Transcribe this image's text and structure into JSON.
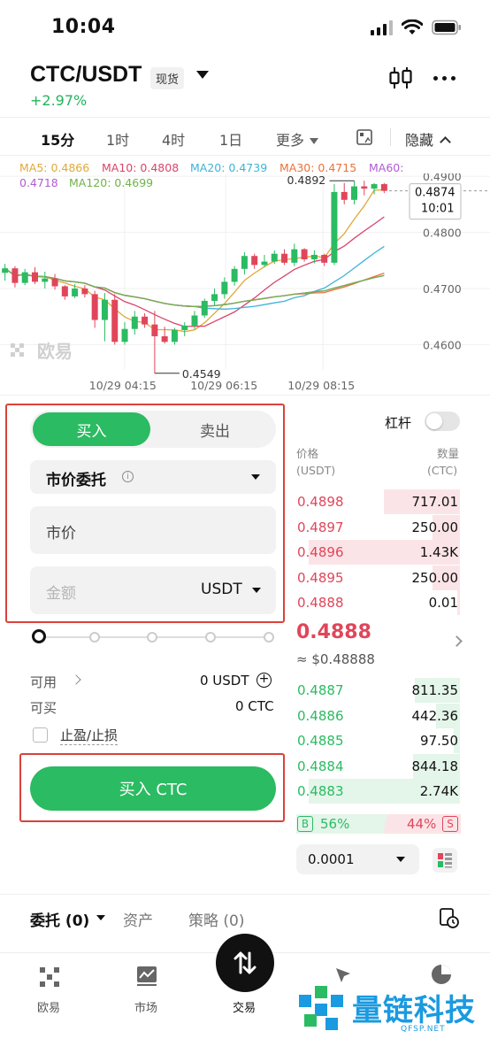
{
  "status_bar": {
    "time": "10:04"
  },
  "header": {
    "pair": "CTC/USDT",
    "badge": "现货",
    "change": "+2.97%",
    "colors": {
      "up": "#2bbb62",
      "down": "#e0465a"
    }
  },
  "intervals": {
    "items": [
      "15分",
      "1时",
      "4时",
      "1日",
      "更多"
    ],
    "hide_label": "隐藏"
  },
  "ma_legend": {
    "ma5": "MA5: 0.4866",
    "ma10": "MA10: 0.4808",
    "ma20": "MA20: 0.4739",
    "ma30": "MA30: 0.4715",
    "ma60_a": "MA60:",
    "ma60_b": "0.4718",
    "ma120": "MA120: 0.4699"
  },
  "chart_data": {
    "type": "candlestick",
    "y_ticks": [
      "0.4900",
      "0.4800",
      "0.4700",
      "0.4600"
    ],
    "x_ticks": [
      "10/29 04:15",
      "10/29 06:15",
      "10/29 08:15"
    ],
    "high_label": "0.4892",
    "low_label": "0.4549",
    "last_price_tag": "0.4874",
    "last_time_tag": "10:01",
    "watermark": "欧易",
    "ylim": [
      0.4555,
      0.4905
    ],
    "candles": [
      [
        0.4728,
        0.4744,
        0.4714,
        0.4736
      ],
      [
        0.4736,
        0.474,
        0.4702,
        0.471
      ],
      [
        0.471,
        0.4735,
        0.4706,
        0.4729
      ],
      [
        0.4729,
        0.4738,
        0.4708,
        0.4712
      ],
      [
        0.4712,
        0.473,
        0.47,
        0.4718
      ],
      [
        0.4718,
        0.4726,
        0.4698,
        0.4704
      ],
      [
        0.4704,
        0.4706,
        0.468,
        0.4686
      ],
      [
        0.4686,
        0.4708,
        0.4683,
        0.47
      ],
      [
        0.47,
        0.4706,
        0.4684,
        0.469
      ],
      [
        0.469,
        0.4696,
        0.463,
        0.4644
      ],
      [
        0.4644,
        0.4692,
        0.4606,
        0.468
      ],
      [
        0.468,
        0.469,
        0.46,
        0.4605
      ],
      [
        0.4605,
        0.464,
        0.46,
        0.4628
      ],
      [
        0.4628,
        0.466,
        0.4618,
        0.465
      ],
      [
        0.465,
        0.4656,
        0.463,
        0.4636
      ],
      [
        0.4636,
        0.466,
        0.4549,
        0.4615
      ],
      [
        0.4615,
        0.4632,
        0.4602,
        0.4605
      ],
      [
        0.4605,
        0.463,
        0.46,
        0.4626
      ],
      [
        0.4626,
        0.464,
        0.4615,
        0.4634
      ],
      [
        0.4634,
        0.466,
        0.4628,
        0.4652
      ],
      [
        0.4652,
        0.4682,
        0.4648,
        0.4678
      ],
      [
        0.4678,
        0.47,
        0.467,
        0.469
      ],
      [
        0.469,
        0.472,
        0.4682,
        0.4712
      ],
      [
        0.4712,
        0.474,
        0.4705,
        0.4735
      ],
      [
        0.4735,
        0.4765,
        0.4725,
        0.4758
      ],
      [
        0.4758,
        0.4762,
        0.4735,
        0.4742
      ],
      [
        0.4742,
        0.476,
        0.4738,
        0.4748
      ],
      [
        0.4748,
        0.4768,
        0.4744,
        0.4762
      ],
      [
        0.4762,
        0.477,
        0.4742,
        0.4746
      ],
      [
        0.4746,
        0.478,
        0.474,
        0.477
      ],
      [
        0.477,
        0.4772,
        0.4748,
        0.4752
      ],
      [
        0.4752,
        0.4768,
        0.4745,
        0.476
      ],
      [
        0.476,
        0.4762,
        0.474,
        0.4746
      ],
      [
        0.4746,
        0.4886,
        0.4742,
        0.4872
      ],
      [
        0.4872,
        0.4888,
        0.485,
        0.4858
      ],
      [
        0.4858,
        0.4892,
        0.485,
        0.4882
      ],
      [
        0.4882,
        0.4892,
        0.4866,
        0.4878
      ],
      [
        0.4878,
        0.4888,
        0.4868,
        0.4886
      ],
      [
        0.4886,
        0.4888,
        0.487,
        0.4874
      ]
    ]
  },
  "order_form": {
    "buy_tab": "买入",
    "sell_tab": "卖出",
    "order_type": "市价委托",
    "price_placeholder": "市价",
    "amount_placeholder": "金额",
    "amount_unit": "USDT",
    "available_label": "可用",
    "available_value": "0 USDT",
    "buyable_label": "可买",
    "buyable_value": "0 CTC",
    "tpsl_label": "止盈/止损",
    "buy_button": "买入 CTC"
  },
  "order_book": {
    "leverage_label": "杠杆",
    "price_header": "价格",
    "price_unit": "(USDT)",
    "qty_header": "数量",
    "qty_unit": "(CTC)",
    "asks": [
      {
        "price": "0.4898",
        "qty": "717.01",
        "depth": 0.5
      },
      {
        "price": "0.4897",
        "qty": "250.00",
        "depth": 0.18
      },
      {
        "price": "0.4896",
        "qty": "1.43K",
        "depth": 1.0
      },
      {
        "price": "0.4895",
        "qty": "250.00",
        "depth": 0.18
      },
      {
        "price": "0.4888",
        "qty": "0.01",
        "depth": 0.02
      }
    ],
    "mid_price": "0.4888",
    "mid_usd": "≈ $0.48888",
    "bids": [
      {
        "price": "0.4887",
        "qty": "811.35",
        "depth": 0.3
      },
      {
        "price": "0.4886",
        "qty": "442.36",
        "depth": 0.16
      },
      {
        "price": "0.4885",
        "qty": "97.50",
        "depth": 0.04
      },
      {
        "price": "0.4884",
        "qty": "844.18",
        "depth": 0.31
      },
      {
        "price": "0.4883",
        "qty": "2.74K",
        "depth": 1.0
      }
    ],
    "buy_ratio_label": "B",
    "buy_ratio": "56%",
    "sell_ratio": "44%",
    "sell_ratio_label": "S",
    "buy_ratio_fraction": 0.56,
    "precision": "0.0001"
  },
  "bottom_tabs": {
    "orders": "委托 (0)",
    "assets": "资产",
    "strategy": "策略 (0)"
  },
  "nav": {
    "okx": "欧易",
    "market": "市场",
    "trade": "交易"
  },
  "watermark": {
    "text": "量链科技",
    "sub": "QFSP.NET"
  }
}
